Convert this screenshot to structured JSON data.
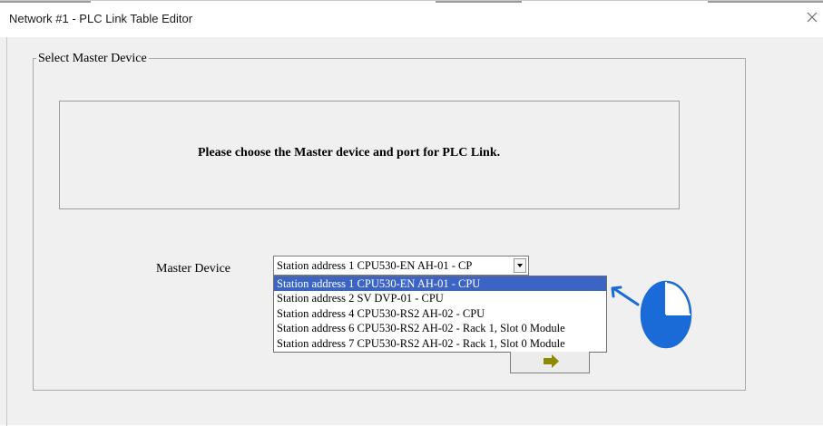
{
  "window": {
    "title": "Network #1 - PLC Link Table Editor",
    "close_label": "×"
  },
  "group": {
    "legend": "Select Master Device"
  },
  "message": {
    "text": "Please choose the Master device and port for PLC Link."
  },
  "master_device": {
    "label": "Master Device",
    "selected_value": "Station address 1  CPU530-EN  AH-01 - CP",
    "options": [
      "Station address 1  CPU530-EN  AH-01 - CPU",
      "Station address 2  SV  DVP-01 - CPU",
      "Station address 4  CPU530-RS2  AH-02 - CPU",
      "Station address 6 CPU530-RS2 AH-02 - Rack 1, Slot 0 Module",
      "Station address 7 CPU530-RS2 AH-02 - Rack 1, Slot 0 Module"
    ],
    "highlighted_index": 0
  },
  "next_button": {
    "icon": "right-arrow-icon",
    "icon_color": "#8b8a00"
  },
  "annotation": {
    "arrow_color": "#1a6ad8",
    "timer_fill_fraction": 0.75
  }
}
